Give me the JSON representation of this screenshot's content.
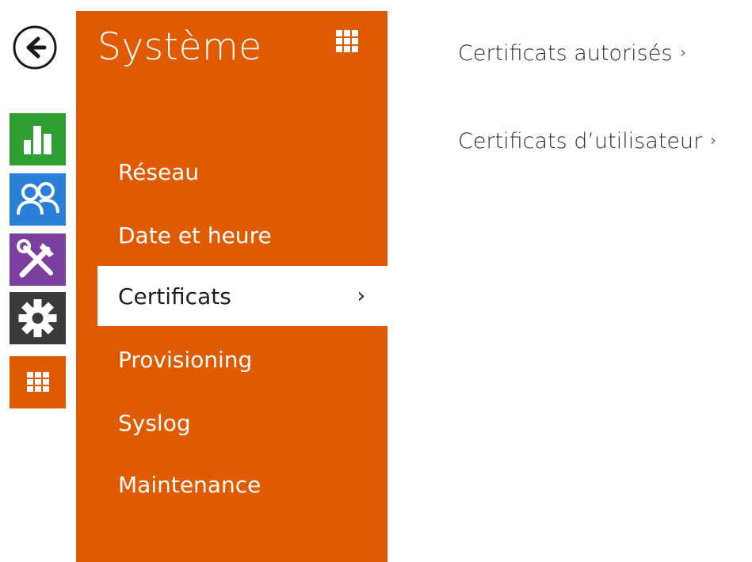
{
  "colors": {
    "accent": "#e05b00",
    "stats": "#2f9e33",
    "users": "#2a7fd6",
    "tools": "#7b3fa0",
    "system": "#3a3a3a",
    "apps": "#e05b00"
  },
  "nav": {
    "back_icon": "arrow-left-circle-icon",
    "rail": [
      {
        "icon": "bar-chart-icon"
      },
      {
        "icon": "users-icon"
      },
      {
        "icon": "tools-icon"
      },
      {
        "icon": "gear-icon"
      },
      {
        "icon": "grid-icon"
      }
    ]
  },
  "panel": {
    "title": "Système",
    "grid_icon": "grid-icon",
    "items": [
      {
        "label": "Réseau"
      },
      {
        "label": "Date et heure"
      },
      {
        "label": "Certificats",
        "active": true,
        "chevron": "›"
      },
      {
        "label": "Provisioning"
      },
      {
        "label": "Syslog"
      },
      {
        "label": "Maintenance"
      }
    ]
  },
  "content": {
    "links": [
      {
        "label": "Certificats autorisés",
        "chevron": "›"
      },
      {
        "label": "Certificats d’utilisateur",
        "chevron": "›"
      }
    ]
  }
}
